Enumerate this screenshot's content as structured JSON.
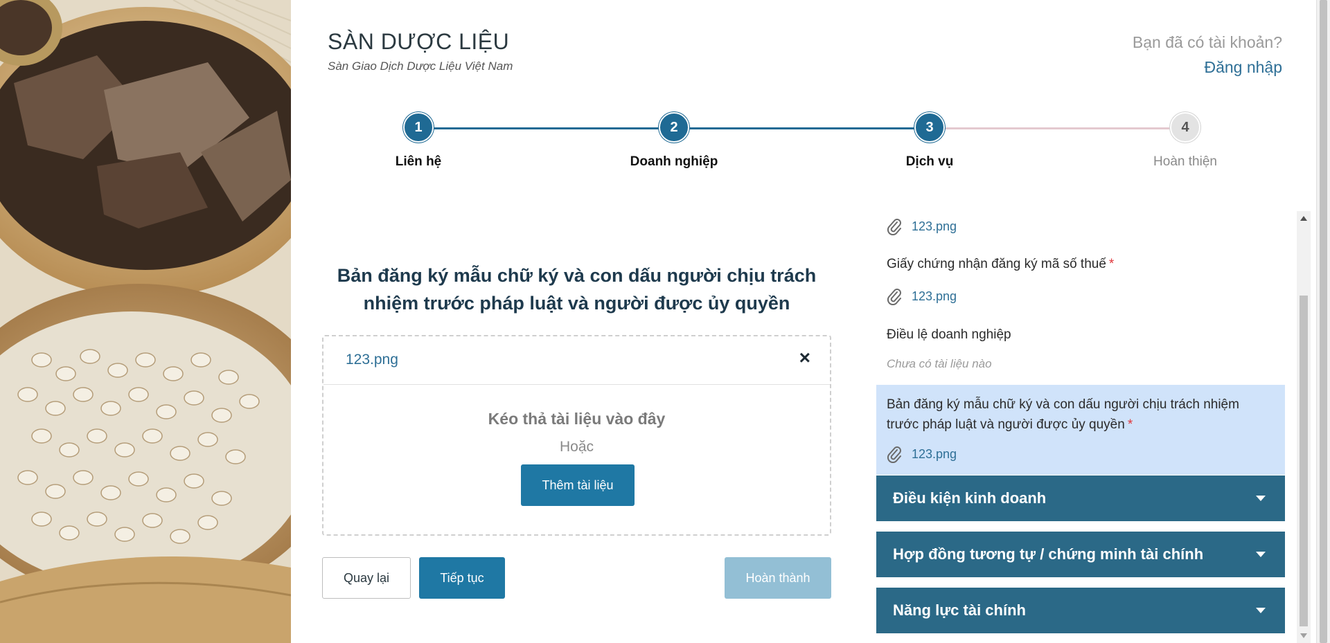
{
  "header": {
    "title": "SÀN DƯỢC LIỆU",
    "subtitle": "Sàn Giao Dịch Dược Liệu Việt Nam",
    "account_question": "Bạn đã có tài khoản?",
    "login_link": "Đăng nhập"
  },
  "stepper": {
    "current_step": 3,
    "steps": [
      {
        "number": "1",
        "label": "Liên hệ"
      },
      {
        "number": "2",
        "label": "Doanh nghiệp"
      },
      {
        "number": "3",
        "label": "Dịch vụ"
      },
      {
        "number": "4",
        "label": "Hoàn thiện"
      }
    ]
  },
  "upload": {
    "title": "Bản đăng ký mẫu chữ ký và con dấu người chịu trách nhiệm trước pháp luật và người được ủy quyền",
    "file_name": "123.png",
    "remove_icon": "×",
    "drop_text": "Kéo thả tài liệu vào đây",
    "or_text": "Hoặc",
    "add_button": "Thêm tài liệu"
  },
  "actions": {
    "back": "Quay lại",
    "next": "Tiếp tục",
    "finish": "Hoàn thành"
  },
  "documents": {
    "top_file": "123.png",
    "tax_certificate": {
      "label": "Giấy chứng nhận đăng ký mã số thuế",
      "required_mark": "*",
      "file": "123.png"
    },
    "charter": {
      "label": "Điều lệ doanh nghiệp",
      "empty_text": "Chưa có tài liệu nào"
    },
    "signature": {
      "label": "Bản đăng ký mẫu chữ ký và con dấu người chịu trách nhiệm trước pháp luật và người được ủy quyền",
      "required_mark": "*",
      "file": "123.png"
    }
  },
  "accordions": [
    {
      "title": "Điều kiện kinh doanh"
    },
    {
      "title": "Hợp đồng tương tự / chứng minh tài chính"
    },
    {
      "title": "Năng lực tài chính"
    }
  ],
  "colors": {
    "primary": "#1f78a4",
    "step_done": "#1f6a94",
    "accordion": "#2b6987",
    "highlight": "#d0e3fa",
    "link": "#2e6f96",
    "required": "#e0363b"
  },
  "icons": {
    "attachment": "paperclip-icon",
    "remove": "close-icon",
    "accordion": "caret-down-icon"
  }
}
